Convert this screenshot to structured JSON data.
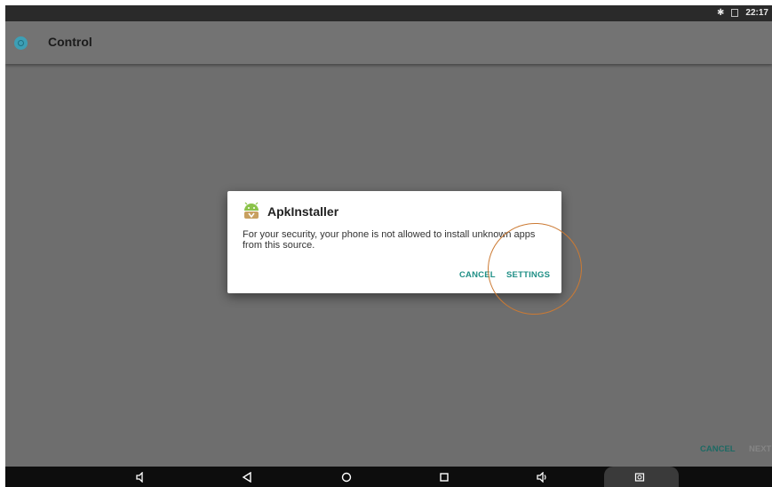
{
  "status_bar": {
    "time": "22:17",
    "icons": [
      "bluetooth-icon",
      "signal-icon"
    ]
  },
  "app_bar": {
    "title": "Control",
    "icon": "power-icon"
  },
  "dialog": {
    "title": "ApkInstaller",
    "icon": "android-installer-icon",
    "message": "For your security, your phone is not allowed to install unknown apps from this source.",
    "cancel_label": "CANCEL",
    "settings_label": "SETTINGS"
  },
  "footer": {
    "cancel_label": "CANCEL",
    "next_label": "NEXT"
  },
  "nav_bar": {
    "buttons": [
      "volume-down-icon",
      "back-icon",
      "home-icon",
      "recents-icon",
      "volume-up-icon",
      "screenshot-icon"
    ]
  },
  "colors": {
    "accent": "#1f8f86",
    "annotation": "#cc7a33",
    "scrim": "#6e6e6e"
  }
}
